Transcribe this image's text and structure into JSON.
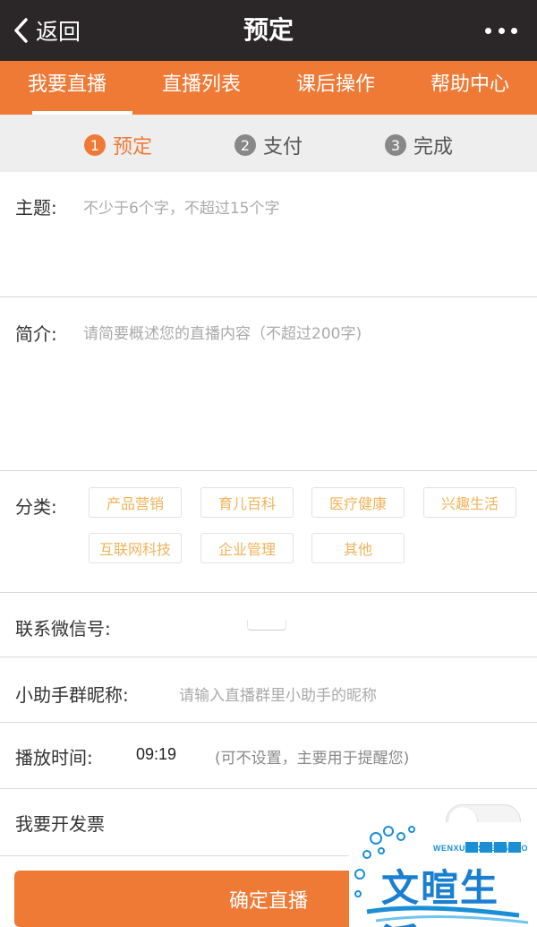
{
  "nav": {
    "back_label": "返回",
    "title": "预定"
  },
  "tabs": [
    {
      "label": "我要直播",
      "active": true
    },
    {
      "label": "直播列表",
      "active": false
    },
    {
      "label": "课后操作",
      "active": false
    },
    {
      "label": "帮助中心",
      "active": false
    }
  ],
  "steps": [
    {
      "num": "1",
      "label": "预定",
      "active": true
    },
    {
      "num": "2",
      "label": "支付",
      "active": false
    },
    {
      "num": "3",
      "label": "完成",
      "active": false
    }
  ],
  "form": {
    "topic_label": "主题:",
    "topic_placeholder": "不少于6个字，不超过15个字",
    "intro_label": "简介:",
    "intro_placeholder": "请简要概述您的直播内容（不超过200字)",
    "category_label": "分类:",
    "categories": [
      "产品营销",
      "育儿百科",
      "医疗健康",
      "兴趣生活",
      "互联网科技",
      "企业管理",
      "其他"
    ],
    "wechat_label": "联系微信号:",
    "assistant_label": "小助手群昵称:",
    "assistant_placeholder": "请输入直播群里小助手的昵称",
    "time_label": "播放时间:",
    "time_value": "09:19",
    "time_hint": "(可不设置，主要用于提醒您)",
    "invoice_label": "我要开发票",
    "invoice_enabled": false
  },
  "submit_label": "确定直播",
  "watermark": {
    "main": "文暄生活",
    "sub": "WENXUANSHENGHUO"
  },
  "colors": {
    "accent": "#ef7a36",
    "titlebar": "#2b2728",
    "tag_text": "#f0b35a"
  }
}
